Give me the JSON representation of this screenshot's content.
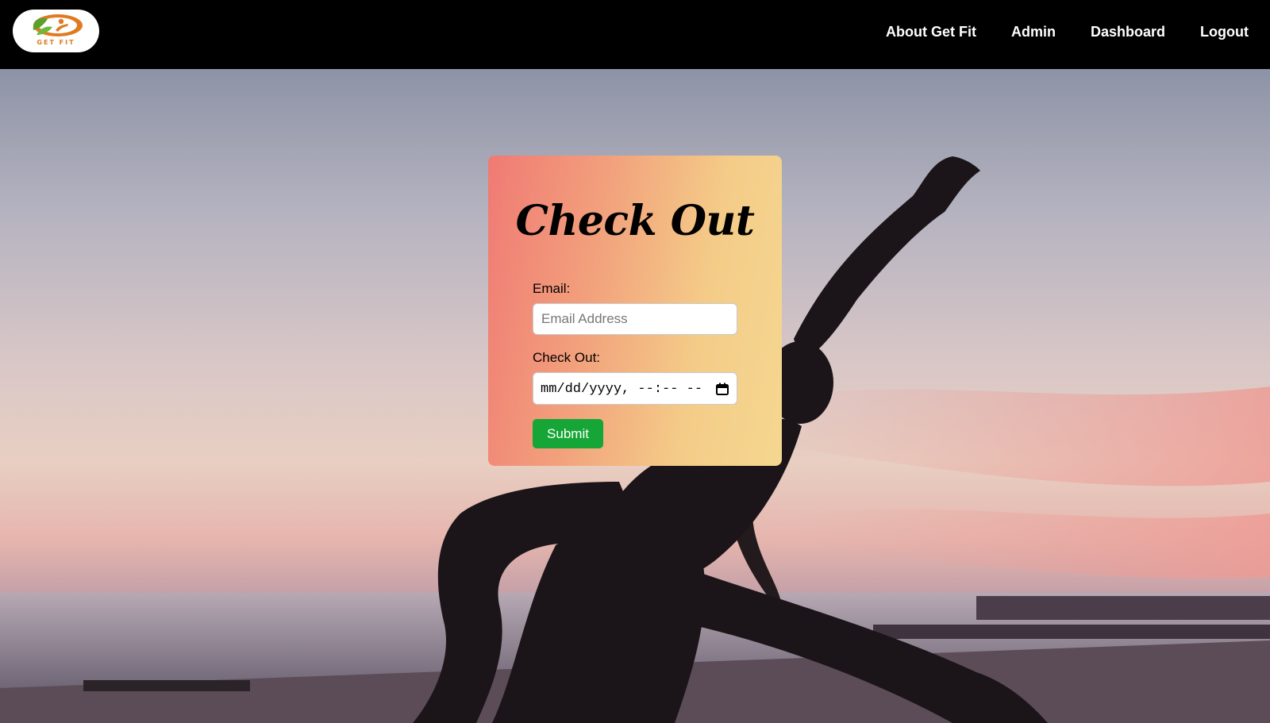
{
  "navbar": {
    "logo_text": "GET FIT",
    "links": [
      "About Get Fit",
      "Admin",
      "Dashboard",
      "Logout"
    ]
  },
  "form": {
    "title": "Check Out",
    "email_label": "Email:",
    "email_placeholder": "Email Address",
    "checkout_label": "Check Out:",
    "datetime_placeholder": "mm/dd/yyyy, --:-- --",
    "submit_label": "Submit"
  },
  "colors": {
    "navbar_bg": "#000000",
    "submit_bg": "#16a637",
    "logo_orange": "#e07a1f",
    "logo_green": "#5aa02c"
  },
  "icons": [
    "get-fit-logo",
    "calendar-icon"
  ]
}
